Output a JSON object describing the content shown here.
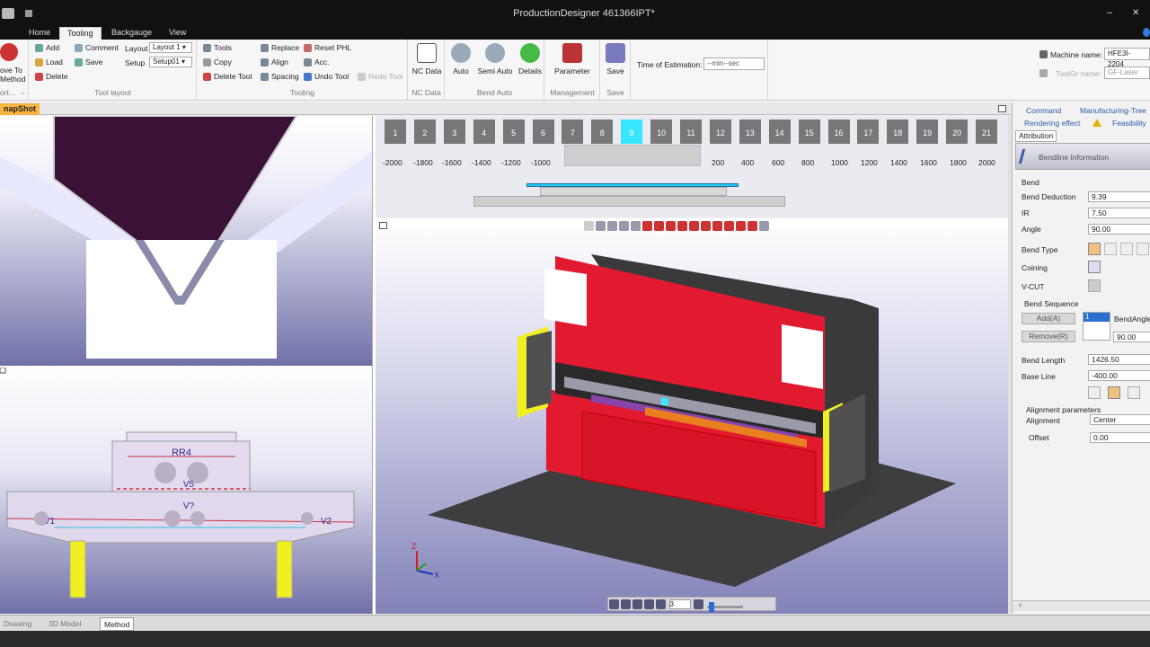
{
  "window": {
    "title": "ProductionDesigner  461366IPT*",
    "minimize": "–",
    "close": "✕"
  },
  "ribbon_tabs": [
    {
      "label": "Home"
    },
    {
      "label": "Tooling"
    },
    {
      "label": "Backgauge"
    },
    {
      "label": "View"
    }
  ],
  "groups": {
    "method": {
      "btn1": "ove To",
      "btn2": "Method",
      "label": "ort...",
      "launcher": "⌐"
    },
    "tool_layout": {
      "add": "Add",
      "load": "Load",
      "delete": "Delete",
      "comment": "Comment",
      "save": "Save",
      "layout_label": "Layout",
      "layout_value": "Layout 1",
      "setup_label": "Setup",
      "setup_value": "Setup01",
      "label": "Tool layout"
    },
    "tooling": {
      "tools": "Tools",
      "copy": "Copy",
      "delete_tool": "Delete Tool",
      "replace": "Replace",
      "align": "Align",
      "spacing": "Spacing",
      "reset_phl": "Reset PHL",
      "acc": "Acc.",
      "undo_tool": "Undo Tool",
      "redo_tool": "Redo Tool",
      "label": "Tooling"
    },
    "nc_data": {
      "btn": "NC Data",
      "label": "NC Data"
    },
    "bend_auto": {
      "auto": "Auto",
      "semi_auto": "Semi Auto",
      "details": "Details",
      "label": "Bend Auto"
    },
    "management": {
      "parameter": "Parameter",
      "label": "Management"
    },
    "save": {
      "btn": "Save",
      "label": "Save"
    },
    "estimation": {
      "label": "Time of Estimation:",
      "value": "--min--sec"
    }
  },
  "machine": {
    "name_label": "Machine name:",
    "name_value": "HFE3I-2204",
    "toolgr_label": "ToolGr name:",
    "toolgr_value": "GF-Laser"
  },
  "snapshot_tab": "napShot",
  "stations": [
    "1",
    "2",
    "3",
    "4",
    "5",
    "6",
    "7",
    "8",
    "9",
    "10",
    "11",
    "12",
    "13",
    "14",
    "15",
    "16",
    "17",
    "18",
    "19",
    "20",
    "21"
  ],
  "ruler": [
    "-2000",
    "-1800",
    "-1600",
    "-1400",
    "-1200",
    "-1000",
    "200",
    "400",
    "600",
    "800",
    "1000",
    "1200",
    "1400",
    "1600",
    "1800",
    "2000"
  ],
  "bottom_view": {
    "labels": {
      "rr4": "RR4",
      "v5": "V5",
      "v7": "V?",
      "v1": "V1",
      "v2": "V2"
    }
  },
  "axes": {
    "z": "Z",
    "x": "X"
  },
  "playback": {
    "step_value": "3"
  },
  "right_panel": {
    "tabs": [
      "Command",
      "Manufacturing-Tree",
      "Rendering effect",
      "Feasibility"
    ],
    "attribution_tab": "Attribution",
    "header": "Bendline Information",
    "bend_label": "Bend",
    "fields": [
      {
        "label": "Bend Deduction",
        "value": "9.39"
      },
      {
        "label": "IR",
        "value": "7.50"
      },
      {
        "label": "Angle",
        "value": "90.00"
      }
    ],
    "bend_type": "Bend Type",
    "coining": "Coining",
    "vcut": "V-CUT",
    "sequence": {
      "label": "Bend Sequence",
      "add": "Add(A)",
      "remove": "Remove(R)",
      "list_value": "1",
      "col": "BendAngle",
      "angle": "90.00"
    },
    "bend_length": {
      "label": "Bend Length",
      "value": "1426.50"
    },
    "base_line": {
      "label": "Base Line",
      "value": "-400.00"
    },
    "alignment": {
      "section": "Alignment parameters",
      "label": "Alignment",
      "value": "Center",
      "offset_label": "Offset",
      "offset_value": "0.00"
    },
    "scroll_left": "‹"
  },
  "bottom_tabs": [
    {
      "label": "Drawing"
    },
    {
      "label": "3D Model"
    },
    {
      "label": "Method"
    }
  ]
}
